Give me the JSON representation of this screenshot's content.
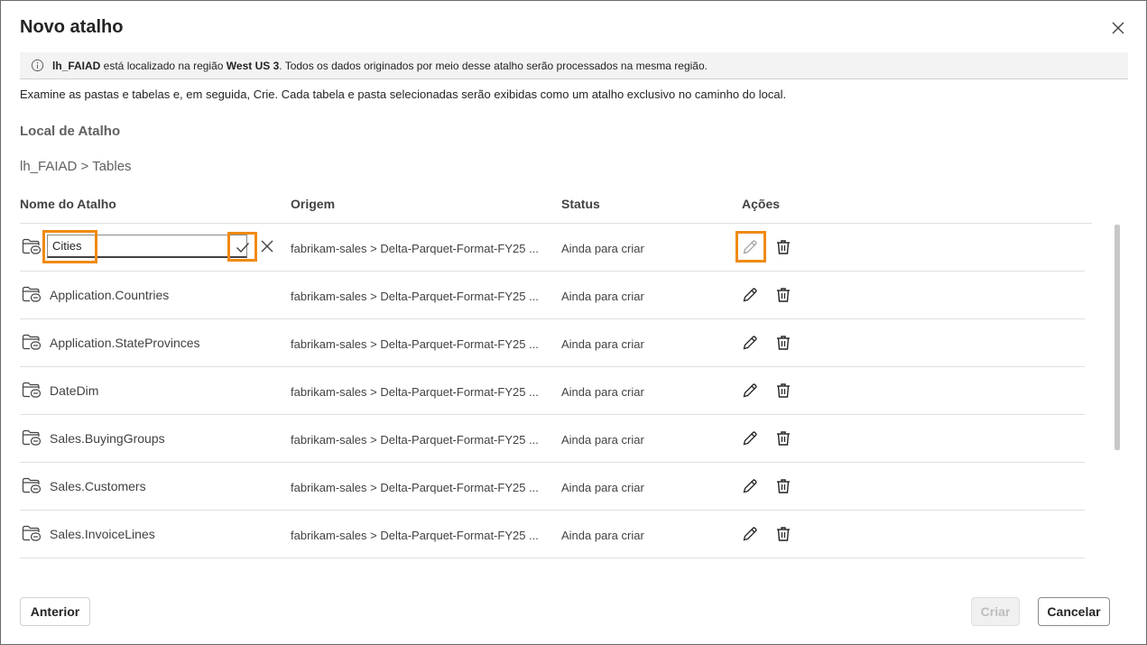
{
  "dialog": {
    "title": "Novo atalho",
    "close_icon": "dismiss-icon"
  },
  "info_bar": {
    "icon": "info-icon",
    "lakehouse": "lh_FAIAD",
    "text_1": " está localizado na região ",
    "region": "West US 3",
    "text_2": ". Todos os dados originados por meio desse atalho serão processados na mesma região."
  },
  "description": "Examine as pastas e tabelas e, em seguida, Crie. Cada tabela e pasta selecionadas serão exibidas como um atalho exclusivo no caminho do local.",
  "location": {
    "label": "Local de Atalho",
    "breadcrumb": "lh_FAIAD > Tables"
  },
  "table": {
    "headers": {
      "name": "Nome do Atalho",
      "origin": "Origem",
      "status": "Status",
      "actions": "Ações"
    },
    "editing_row": {
      "name_value": "Cities",
      "origin": "fabrikam-sales > Delta-Parquet-Format-FY25 ...",
      "status": "Ainda para criar"
    },
    "rows": [
      {
        "name": "Application.Countries",
        "origin": "fabrikam-sales > Delta-Parquet-Format-FY25 ...",
        "status": "Ainda para criar"
      },
      {
        "name": "Application.StateProvinces",
        "origin": "fabrikam-sales > Delta-Parquet-Format-FY25 ...",
        "status": "Ainda para criar"
      },
      {
        "name": "DateDim",
        "origin": "fabrikam-sales > Delta-Parquet-Format-FY25 ...",
        "status": "Ainda para criar"
      },
      {
        "name": "Sales.BuyingGroups",
        "origin": "fabrikam-sales > Delta-Parquet-Format-FY25 ...",
        "status": "Ainda para criar"
      },
      {
        "name": "Sales.Customers",
        "origin": "fabrikam-sales > Delta-Parquet-Format-FY25 ...",
        "status": "Ainda para criar"
      },
      {
        "name": "Sales.InvoiceLines",
        "origin": "fabrikam-sales > Delta-Parquet-Format-FY25 ...",
        "status": "Ainda para criar"
      }
    ],
    "icons": {
      "row_icon": "folder-shortcut-icon",
      "edit_icon": "pencil-icon",
      "delete_icon": "trash-icon",
      "confirm_icon": "checkmark-icon",
      "cancel_icon": "dismiss-icon"
    }
  },
  "footer": {
    "back_label": "Anterior",
    "create_label": "Criar",
    "cancel_label": "Cancelar"
  },
  "colors": {
    "highlight": "#f08a14",
    "info_bar_bg": "#f3f3f3",
    "disabled_text": "#bdbdbd"
  }
}
